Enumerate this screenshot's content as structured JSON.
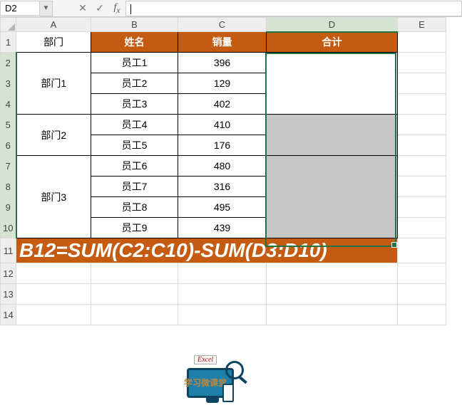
{
  "namebox": "D2",
  "formula_input": "",
  "col_headers": [
    "A",
    "B",
    "C",
    "D",
    "E"
  ],
  "selected_col": "D",
  "row_headers": [
    "1",
    "2",
    "3",
    "4",
    "5",
    "6",
    "7",
    "8",
    "9",
    "10",
    "11",
    "12",
    "13",
    "14"
  ],
  "selected_rows": [
    "2",
    "3",
    "4",
    "5",
    "6",
    "7",
    "8",
    "9",
    "10"
  ],
  "headers": {
    "dept": "部门",
    "name": "姓名",
    "sales": "销量",
    "total": "合计"
  },
  "departments": [
    {
      "label": "部门1",
      "span": 3
    },
    {
      "label": "部门2",
      "span": 2
    },
    {
      "label": "部门3",
      "span": 4
    }
  ],
  "rows": [
    {
      "name": "员工1",
      "sales": "396",
      "d_gray": false
    },
    {
      "name": "员工2",
      "sales": "129",
      "d_gray": false
    },
    {
      "name": "员工3",
      "sales": "402",
      "d_gray": false
    },
    {
      "name": "员工4",
      "sales": "410",
      "d_gray": true
    },
    {
      "name": "员工5",
      "sales": "176",
      "d_gray": true
    },
    {
      "name": "员工6",
      "sales": "480",
      "d_gray": true
    },
    {
      "name": "员工7",
      "sales": "316",
      "d_gray": true
    },
    {
      "name": "员工8",
      "sales": "495",
      "d_gray": true
    },
    {
      "name": "员工9",
      "sales": "439",
      "d_gray": true
    }
  ],
  "formula_banner": "B12=SUM(C2:C10)-SUM(D3:D10)",
  "watermark": {
    "tag": "Excel",
    "chinese": "学习微课堂"
  }
}
